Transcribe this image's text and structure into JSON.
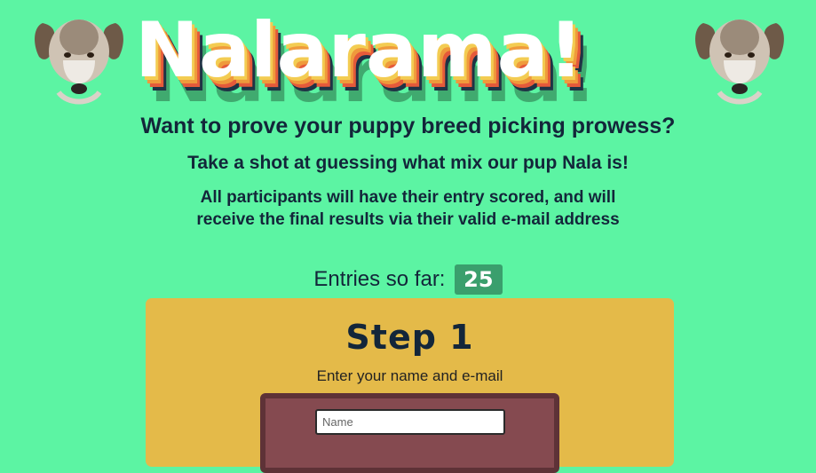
{
  "header": {
    "title": "Nalarama!",
    "left_image": "puppy-head",
    "right_image": "puppy-head"
  },
  "intro": {
    "headline": "Want to prove your puppy breed picking prowess?",
    "subheadline": "Take a shot at guessing what mix our pup Nala is!",
    "note": "All participants will have their entry scored, and will receive the final results via their valid e-mail address"
  },
  "entries": {
    "label": "Entries so far:",
    "count": "25"
  },
  "step": {
    "title": "Step 1",
    "instruction": "Enter your name and e-mail",
    "name_placeholder": "Name"
  },
  "colors": {
    "background": "#5cf4a3",
    "card": "#e4ba49",
    "form_panel": "#854a50",
    "count_badge": "#3a9f6d",
    "text": "#13263a"
  }
}
